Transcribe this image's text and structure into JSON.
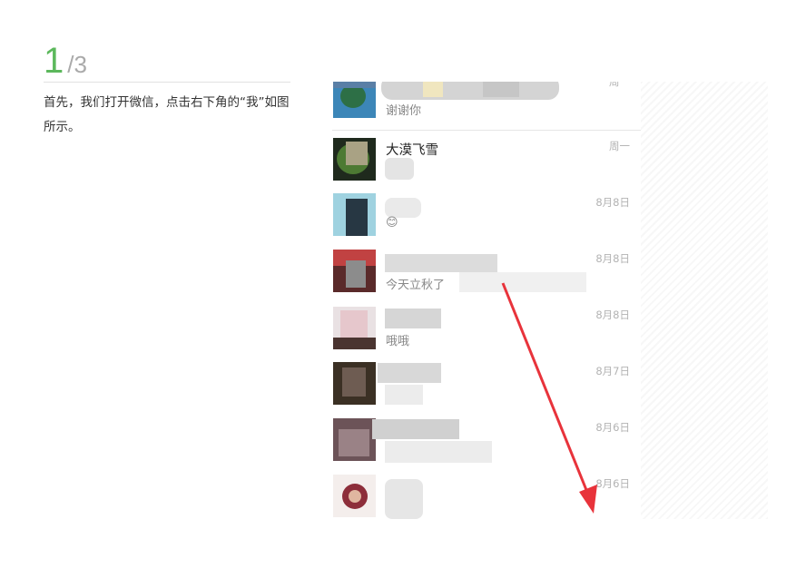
{
  "step": {
    "current": "1",
    "total": "/3",
    "text": "首先，我们打开微信，点击右下角的“我”如图所示。"
  },
  "chat_list": [
    {
      "name": "",
      "message": "谢谢你",
      "time": "周一"
    },
    {
      "name": "大漠飞雪",
      "message": "",
      "time": "周一"
    },
    {
      "name": "",
      "message": "😊",
      "time": "8月8日"
    },
    {
      "name": "",
      "message": "今天立秋了",
      "time": "8月8日"
    },
    {
      "name": "",
      "message": "哦哦",
      "time": "8月8日"
    },
    {
      "name": "",
      "message": "",
      "time": "8月7日"
    },
    {
      "name": "",
      "message": "",
      "time": "8月6日"
    },
    {
      "name": "",
      "message": "",
      "time": "8月6日"
    }
  ],
  "colors": {
    "step_accent": "#5cb85c",
    "arrow": "#e8333b"
  },
  "icons": {
    "pointer": "red-arrow-icon"
  }
}
